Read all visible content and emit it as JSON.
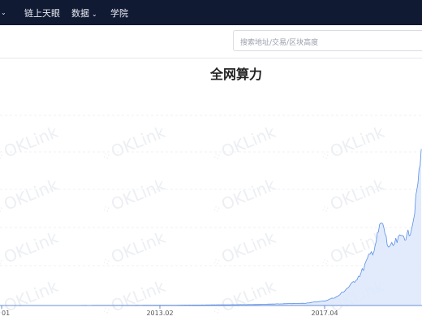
{
  "nav": {
    "items": [
      {
        "label": "链上天眼"
      },
      {
        "label": "数据"
      },
      {
        "label": "学院"
      }
    ]
  },
  "search": {
    "placeholder": "搜索地址/交易/区块高度"
  },
  "watermark": "OKLink",
  "colors": {
    "nav_bg": "#111a33",
    "line": "#5b8ee6",
    "area": "#dce8fb"
  },
  "chart_data": {
    "type": "area",
    "title": "全网算力",
    "xlabel": "",
    "ylabel": "",
    "x_ticks": [
      "01",
      "2013.02",
      "2017.04"
    ],
    "series": [
      {
        "values": [
          {
            "x": "2009.01",
            "y": 0.0
          },
          {
            "x": "2013.02",
            "y": 0.001
          },
          {
            "x": "2015.06",
            "y": 0.004
          },
          {
            "x": "2016.10",
            "y": 0.01
          },
          {
            "x": "2017.04",
            "y": 0.02
          },
          {
            "x": "2017.08",
            "y": 0.04
          },
          {
            "x": "2017.12",
            "y": 0.09
          },
          {
            "x": "2018.03",
            "y": 0.14
          },
          {
            "x": "2018.05",
            "y": 0.2
          },
          {
            "x": "2018.07",
            "y": 0.25
          },
          {
            "x": "2018.08",
            "y": 0.3
          },
          {
            "x": "2018.09",
            "y": 0.36
          },
          {
            "x": "2018.10",
            "y": 0.34
          },
          {
            "x": "2018.11",
            "y": 0.27
          },
          {
            "x": "2018.12",
            "y": 0.25
          },
          {
            "x": "2019.02",
            "y": 0.28
          },
          {
            "x": "2019.04",
            "y": 0.31
          },
          {
            "x": "2019.05",
            "y": 0.3
          },
          {
            "x": "2019.06",
            "y": 0.33
          },
          {
            "x": "2019.07",
            "y": 0.38
          },
          {
            "x": "2019.08",
            "y": 0.5
          },
          {
            "x": "2019.09",
            "y": 0.62
          },
          {
            "x": "2019.10",
            "y": 0.8
          },
          {
            "x": "2019.11",
            "y": 0.92
          }
        ]
      }
    ],
    "grid": true
  }
}
